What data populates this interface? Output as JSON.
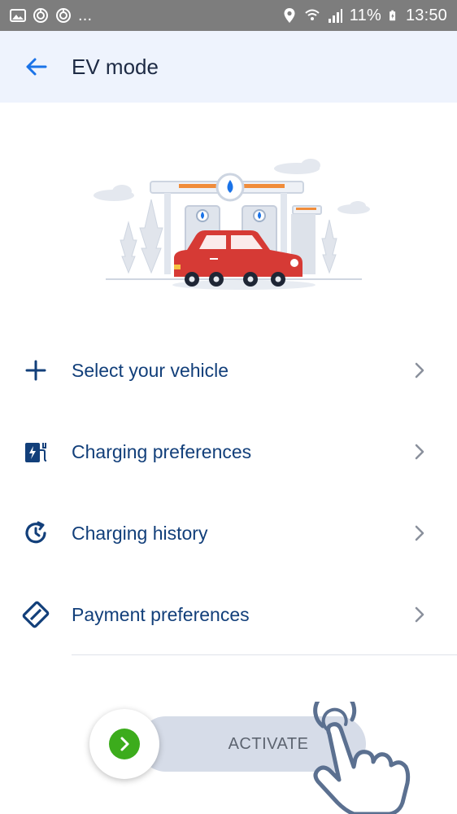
{
  "status_bar": {
    "left_icons": [
      "image-icon",
      "sync-icon",
      "sync-icon"
    ],
    "ellipsis": "...",
    "battery_percent": "11%",
    "time": "13:50"
  },
  "app_bar": {
    "title": "EV mode",
    "back_icon": "arrow-left-icon"
  },
  "menu": {
    "items": [
      {
        "label": "Select your vehicle",
        "icon": "plus-icon"
      },
      {
        "label": "Charging preferences",
        "icon": "ev-charger-icon"
      },
      {
        "label": "Charging history",
        "icon": "history-icon"
      },
      {
        "label": "Payment preferences",
        "icon": "card-icon"
      }
    ]
  },
  "activate": {
    "label": "ACTIVATE",
    "knob_icon": "chevron-right-icon"
  },
  "colors": {
    "accent": "#123f7a",
    "appbar_bg": "#eef3fd",
    "knob_green": "#3cac1c",
    "car_red": "#d63a35"
  }
}
